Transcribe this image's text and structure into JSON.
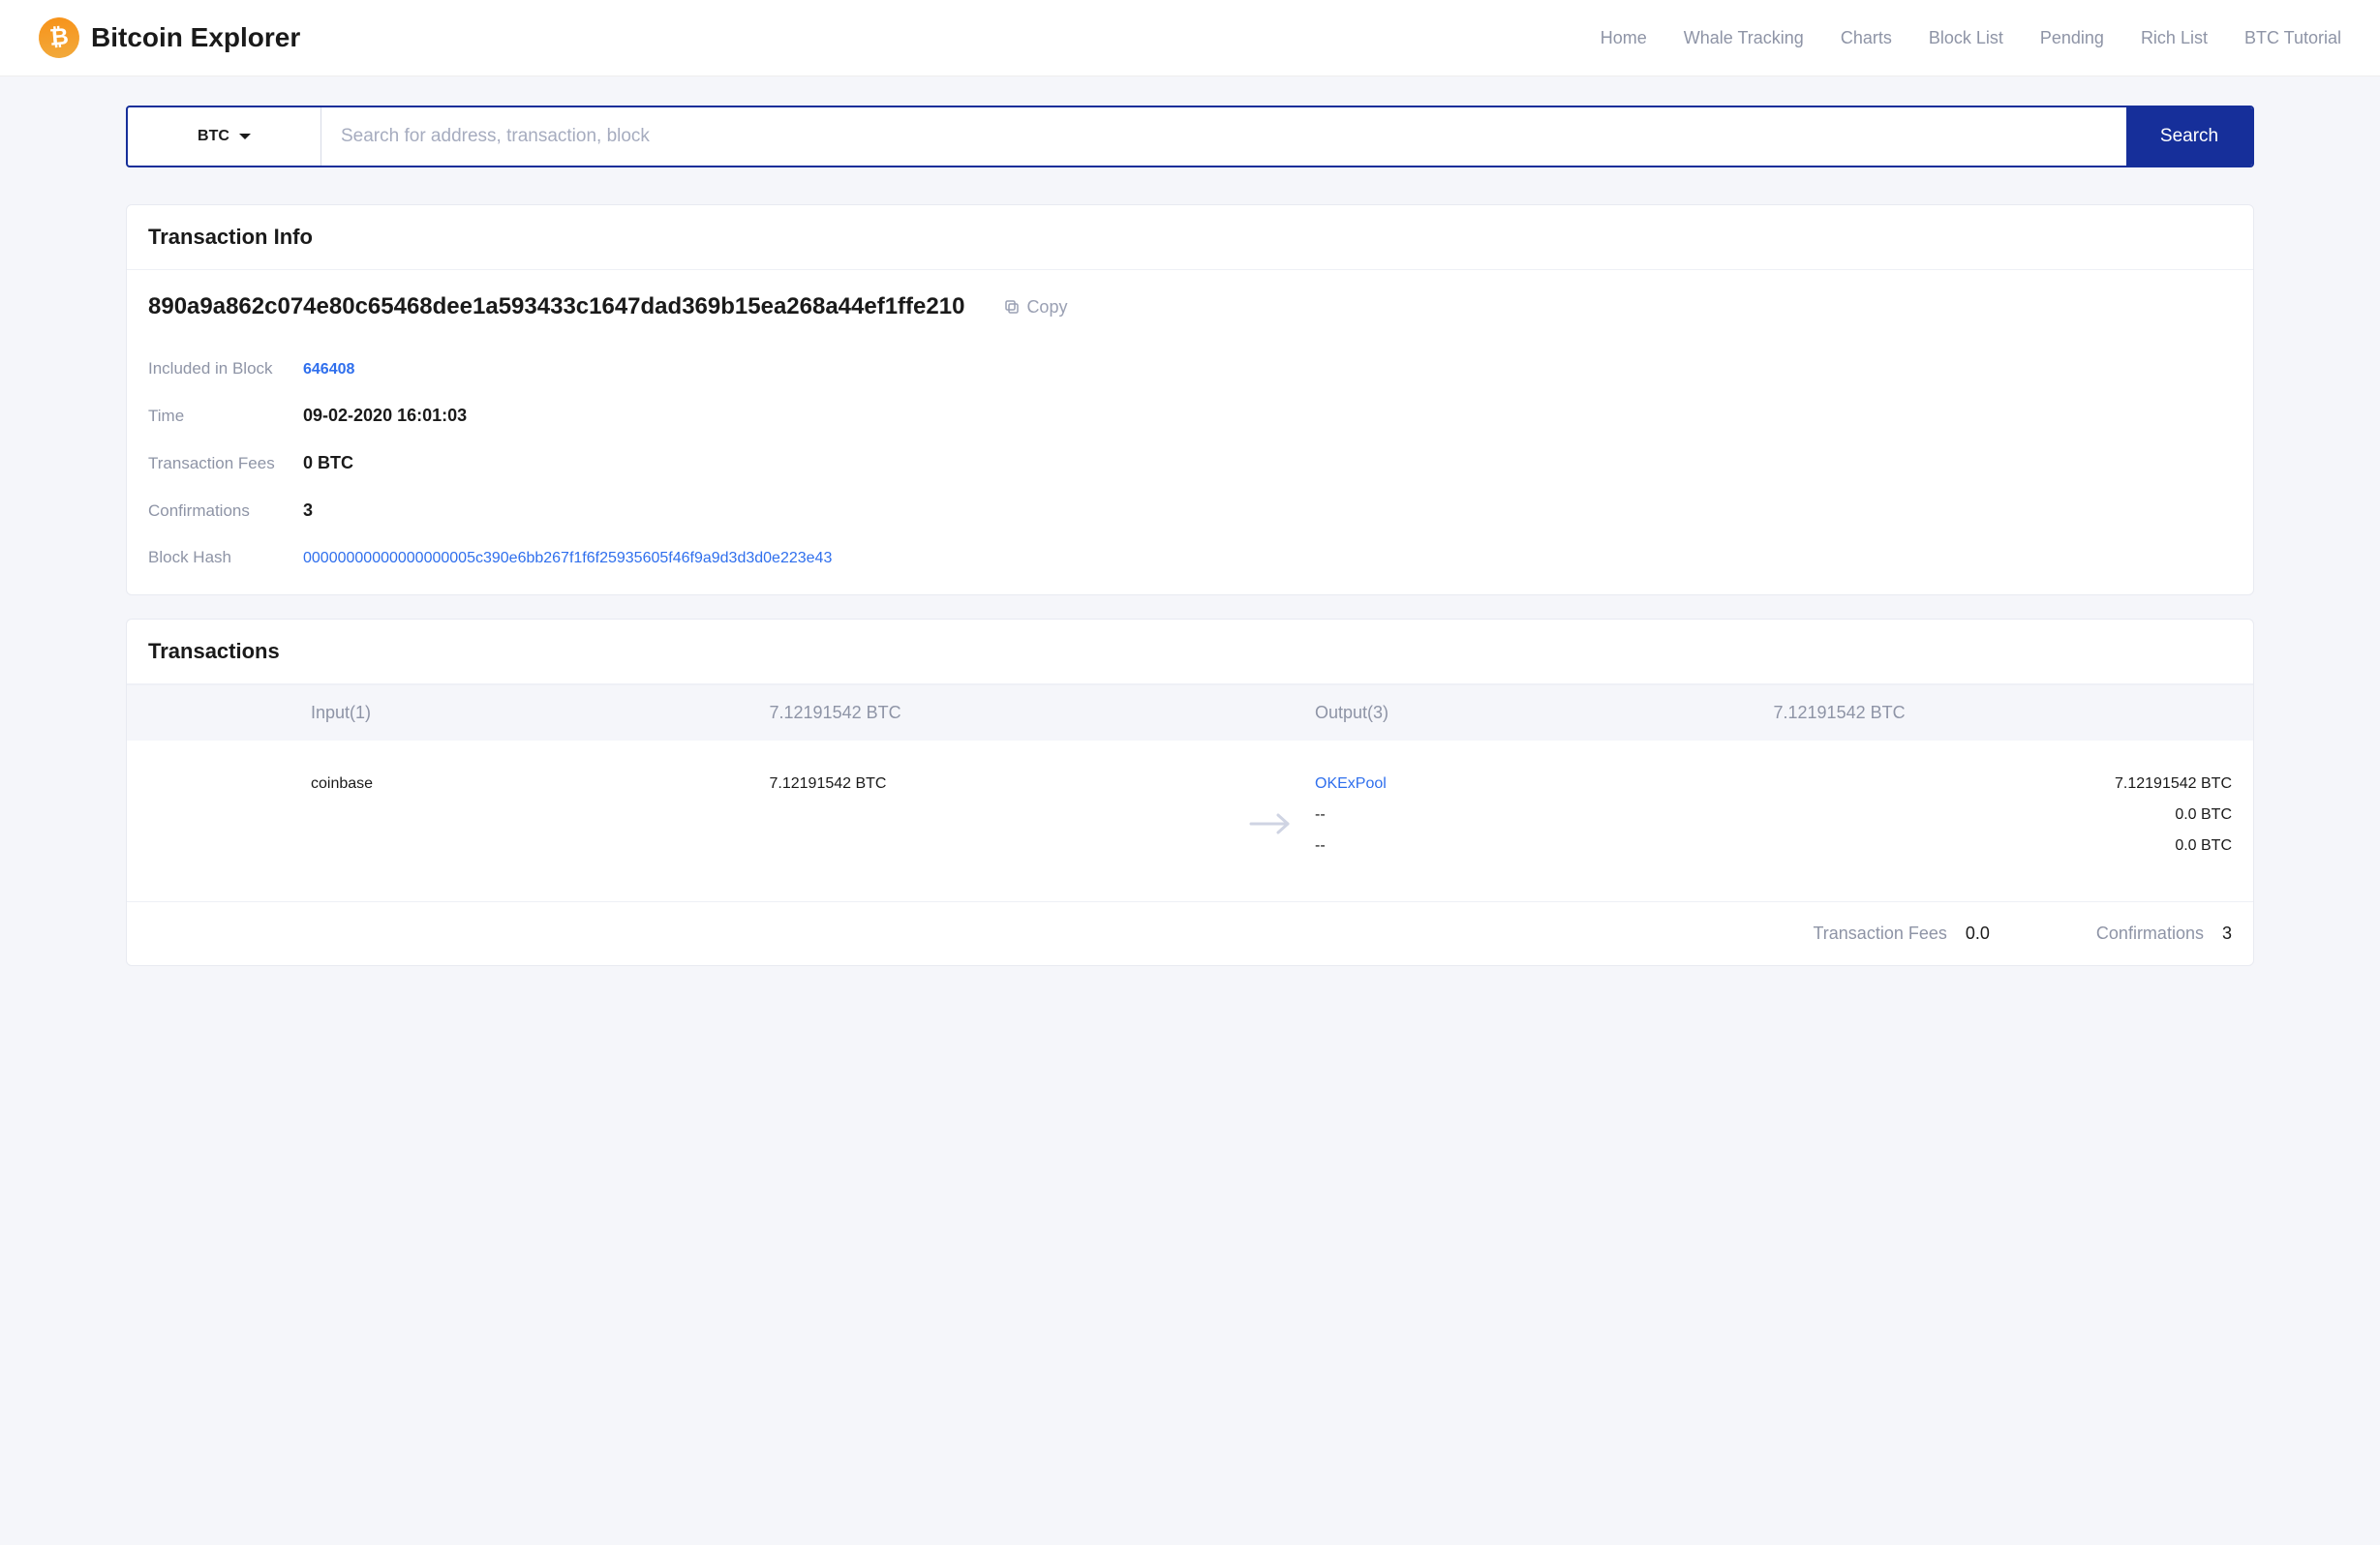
{
  "brand": {
    "title": "Bitcoin Explorer",
    "logo_glyph": "₿"
  },
  "nav": {
    "items": [
      "Home",
      "Whale Tracking",
      "Charts",
      "Block List",
      "Pending",
      "Rich List",
      "BTC Tutorial"
    ]
  },
  "search": {
    "coin": "BTC",
    "placeholder": "Search for address, transaction, block",
    "button_label": "Search"
  },
  "tx_info": {
    "heading": "Transaction Info",
    "hash": "890a9a862c074e80c65468dee1a593433c1647dad369b15ea268a44ef1ffe210",
    "copy_label": "Copy",
    "rows": {
      "included_in_block": {
        "label": "Included in Block",
        "value": "646408"
      },
      "time": {
        "label": "Time",
        "value": "09-02-2020 16:01:03"
      },
      "fees": {
        "label": "Transaction Fees",
        "value": "0 BTC"
      },
      "confirmations": {
        "label": "Confirmations",
        "value": "3"
      },
      "block_hash": {
        "label": "Block Hash",
        "value": "00000000000000000005c390e6bb267f1f6f25935605f46f9a9d3d3d0e223e43"
      }
    }
  },
  "transactions": {
    "heading": "Transactions",
    "header_bar": {
      "input_label": "Input(1)",
      "input_total": "7.12191542 BTC",
      "output_label": "Output(3)",
      "output_total": "7.12191542 BTC"
    },
    "inputs": [
      {
        "label": "coinbase",
        "amount": "7.12191542 BTC"
      }
    ],
    "outputs": [
      {
        "label": "OKExPool",
        "amount": "7.12191542 BTC",
        "is_link": true
      },
      {
        "label": "--",
        "amount": "0.0 BTC",
        "is_link": false
      },
      {
        "label": "--",
        "amount": "0.0 BTC",
        "is_link": false
      }
    ],
    "footer": {
      "fees_label": "Transaction Fees",
      "fees_value": "0.0",
      "confirmations_label": "Confirmations",
      "confirmations_value": "3"
    }
  }
}
